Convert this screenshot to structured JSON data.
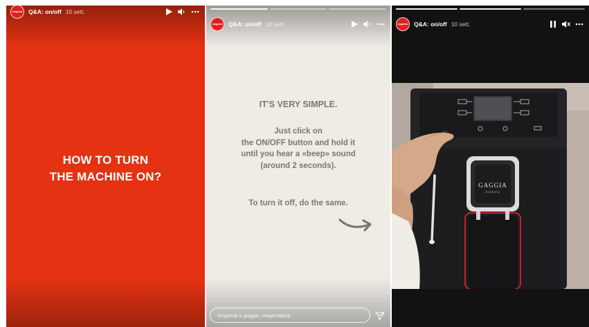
{
  "stories": [
    {
      "username": "Q&A: on/off",
      "timestamp": "10 sett.",
      "avatar_text": "magenta",
      "message": [
        "HOW TO TURN",
        "THE MACHINE ON?"
      ],
      "bg": "#e43212"
    },
    {
      "username": "Q&A: on/off",
      "timestamp": "10 sett.",
      "avatar_text": "magenta",
      "heading": "IT'S VERY SIMPLE.",
      "body": [
        "Just click on",
        "the ON/OFF button and hold it",
        "until you hear a «beep» sound",
        "(around 2 seconds)."
      ],
      "turn_off": "To turn it off, do the same.",
      "reply_placeholder": "Rispondi a gaggia_magentahub...",
      "bg": "#efece6"
    },
    {
      "username": "Q&A: on/off",
      "timestamp": "10 sett.",
      "avatar_text": "magenta",
      "brand_logo": "GAGGIA",
      "brand_sub": "MAGENTA",
      "bg": "#121212"
    }
  ],
  "icons": {
    "play": "play-icon",
    "pause": "pause-icon",
    "volume": "volume-icon",
    "muted": "mute-icon",
    "more": "more-icon",
    "send": "send-icon"
  },
  "colors": {
    "accent_red": "#e43212",
    "machine_trim": "#c4222a"
  }
}
